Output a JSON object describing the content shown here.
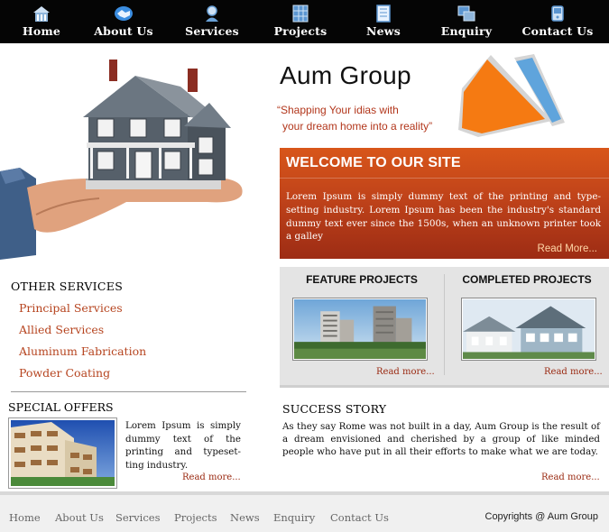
{
  "nav": {
    "items": [
      {
        "label": "Home",
        "icon": "home-icon"
      },
      {
        "label": "About Us",
        "icon": "handshake-icon"
      },
      {
        "label": "Services",
        "icon": "person-icon"
      },
      {
        "label": "Projects",
        "icon": "building-icon"
      },
      {
        "label": "News",
        "icon": "newspaper-icon"
      },
      {
        "label": "Enquiry",
        "icon": "enquiry-icon"
      },
      {
        "label": "Contact Us",
        "icon": "phone-icon"
      }
    ]
  },
  "brand": {
    "title": "Aum Group",
    "tagline_line1": "“Shapping Your idias with",
    "tagline_line2": "your dream home into a reality”"
  },
  "welcome": {
    "title": "WELCOME TO OUR SITE",
    "text": "Lorem Ipsum is simply dummy text of the printing and type-setting industry. Lorem Ipsum has been the industry's standard dummy text ever since the 1500s, when an unknown printer took a galley",
    "more": "Read More..."
  },
  "projects": {
    "feature_title": "FEATURE PROJECTS",
    "feature_more": "Read more...",
    "completed_title": "COMPLETED PROJECTS",
    "completed_more": "Read more..."
  },
  "other_services": {
    "title": "OTHER SERVICES",
    "items": [
      "Principal Services",
      "Allied Services",
      "Aluminum Fabrication",
      "Powder Coating"
    ]
  },
  "special_offers": {
    "title": "SPECIAL OFFERS",
    "text": "Lorem Ipsum is simply dummy text of the printing and typeset-ting industry.",
    "more": "Read more..."
  },
  "success_story": {
    "title": "SUCCESS STORY",
    "text": "As they say Rome was not built in a day, Aum Group is the result of a dream envisioned and cherished by a group of like minded people who have put in all their efforts to make what we are today.",
    "more": "Read more..."
  },
  "footer": {
    "links": [
      "Home",
      "About Us",
      "Services",
      "Projects",
      "News",
      "Enquiry",
      "Contact Us"
    ],
    "copyright": "Copyrights @ Aum Group"
  },
  "colors": {
    "nav_bg": "#050505",
    "accent": "#c0431a",
    "link": "#b6441f",
    "logo_orange": "#f57a12",
    "logo_blue": "#5fa4dc"
  }
}
